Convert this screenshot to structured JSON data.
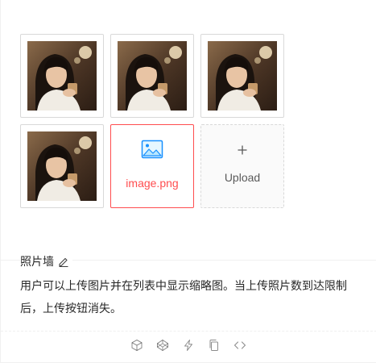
{
  "upload": {
    "files": [
      {
        "status": "done",
        "image": "portrait-photo"
      },
      {
        "status": "done",
        "image": "portrait-photo"
      },
      {
        "status": "done",
        "image": "portrait-photo"
      },
      {
        "status": "done",
        "image": "portrait-photo"
      },
      {
        "status": "error",
        "name": "image.png",
        "icon": "picture-icon"
      }
    ],
    "trigger_icon": "plus-icon",
    "trigger_label": "Upload",
    "error_color": "#ff4d4f",
    "accent_color": "#1890ff"
  },
  "meta": {
    "title": "照片墙",
    "title_icon": "edit-icon",
    "description": "用户可以上传图片并在列表中显示缩略图。当上传照片数到达限制后，上传按钮消失。"
  },
  "actions": [
    {
      "icon": "codesandbox-icon"
    },
    {
      "icon": "codepen-icon"
    },
    {
      "icon": "thunderbolt-icon"
    },
    {
      "icon": "copy-icon"
    },
    {
      "icon": "code-expand-icon"
    }
  ]
}
